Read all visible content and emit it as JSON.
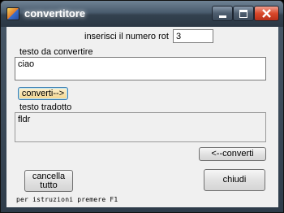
{
  "window": {
    "title": "convertitore",
    "icon": "app-icon",
    "controls": {
      "minimize": "minimize-icon",
      "maximize": "maximize-icon",
      "close": "close-icon"
    },
    "colors": {
      "close": "#d9482a",
      "client": "#f0f0f0"
    }
  },
  "rotation": {
    "label": "inserisci il numero rot",
    "value": "3"
  },
  "input": {
    "label": "testo da convertire",
    "value": "ciao"
  },
  "encode_button": "converti-->",
  "output": {
    "label": "testo tradotto",
    "value": "fldr"
  },
  "decode_button": "<--converti",
  "clear_button": "cancella tutto",
  "close_button": "chiudi",
  "help_hint": "per istruzioni premere F1"
}
